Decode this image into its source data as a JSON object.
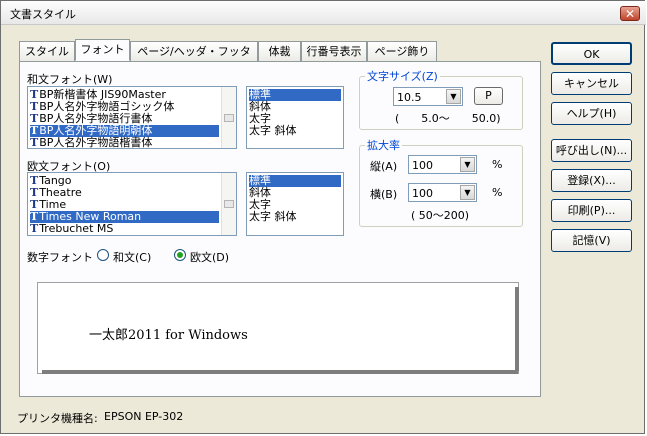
{
  "window": {
    "title": "文書スタイル",
    "close_label": "✕"
  },
  "tabs": [
    {
      "label": "スタイル"
    },
    {
      "label": "フォント"
    },
    {
      "label": "ページ/ヘッダ・フッタ"
    },
    {
      "label": "体裁"
    },
    {
      "label": "行番号表示"
    },
    {
      "label": "ページ飾り"
    }
  ],
  "japanese_font": {
    "label": "和文フォント(W)",
    "items": [
      {
        "name": "BP新楷書体 JIS90Master",
        "icon": "truetype-icon"
      },
      {
        "name": "BP人名外字物語ゴシック体",
        "icon": "truetype-icon"
      },
      {
        "name": "BP人名外字物語行書体",
        "icon": "truetype-icon"
      },
      {
        "name": "BP人名外字物語明朝体",
        "icon": "truetype-icon",
        "selected": true
      },
      {
        "name": "BP人名外字物語楷書体",
        "icon": "truetype-icon"
      }
    ],
    "styles": [
      "標準",
      "斜体",
      "太字",
      "太字 斜体"
    ]
  },
  "western_font": {
    "label": "欧文フォント(O)",
    "items": [
      {
        "name": "Tango",
        "icon": "truetype-icon"
      },
      {
        "name": "Theatre",
        "icon": "truetype-icon"
      },
      {
        "name": "Time",
        "icon": "truetype-icon"
      },
      {
        "name": "Times New Roman",
        "icon": "truetype-icon",
        "selected": true
      },
      {
        "name": "Trebuchet MS",
        "icon": "truetype-icon"
      }
    ],
    "styles": [
      "標準",
      "斜体",
      "太字",
      "太字 斜体"
    ]
  },
  "number_font": {
    "label": "数字フォント",
    "options": [
      {
        "label": "和文(C)",
        "checked": false
      },
      {
        "label": "欧文(D)",
        "checked": true
      }
    ]
  },
  "char_size": {
    "title": "文字サイズ(Z)",
    "value": "10.5",
    "p_button": "P",
    "range": "(　　5.0〜　　50.0)"
  },
  "scale": {
    "title": "拡大率",
    "vertical_label": "縦(A)",
    "vertical_value": "100",
    "horizontal_label": "横(B)",
    "horizontal_value": "100",
    "unit": "%",
    "range": "( 50〜200)"
  },
  "preview": {
    "text": "一太郎2011 for Windows"
  },
  "printer": {
    "label": "プリンタ機種名:",
    "value": "EPSON EP-302"
  },
  "buttons": [
    "OK",
    "キャンセル",
    "ヘルプ(H)",
    "呼び出し(N)...",
    "登録(X)...",
    "印刷(P)...",
    "記憶(V)"
  ]
}
